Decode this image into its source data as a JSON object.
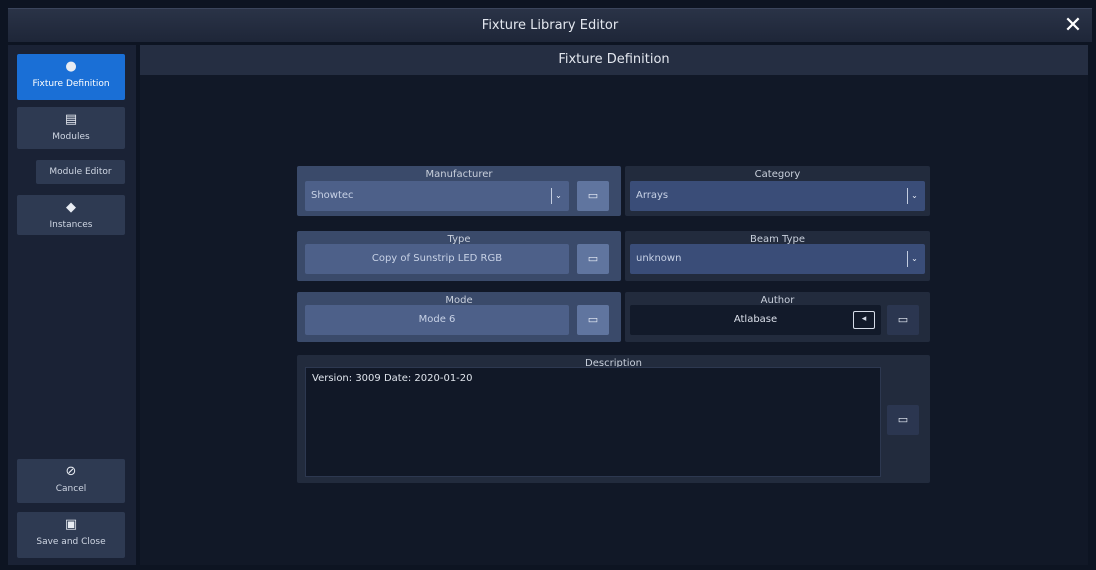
{
  "window": {
    "title": "Fixture Library Editor",
    "close_glyph": "✕"
  },
  "sidebar": {
    "items": [
      {
        "label": "Fixture Definition",
        "icon": "fixture-icon",
        "glyph": "●"
      },
      {
        "label": "Modules",
        "icon": "document-icon",
        "glyph": "▤"
      },
      {
        "label": "Module Editor"
      },
      {
        "label": "Instances",
        "icon": "stack-icon",
        "glyph": "◆"
      }
    ],
    "cancel": {
      "label": "Cancel",
      "icon": "cancel-icon",
      "glyph": "⊘"
    },
    "save": {
      "label": "Save and Close",
      "icon": "save-icon",
      "glyph": "▣"
    }
  },
  "main": {
    "header": "Fixture Definition",
    "manufacturer": {
      "label": "Manufacturer",
      "value": "Showtec"
    },
    "category": {
      "label": "Category",
      "value": "Arrays"
    },
    "type": {
      "label": "Type",
      "value": "Copy of Sunstrip LED RGB"
    },
    "beam_type": {
      "label": "Beam Type",
      "value": "unknown"
    },
    "mode": {
      "label": "Mode",
      "value": "Mode 6"
    },
    "author": {
      "label": "Author",
      "value": "Atlabase"
    },
    "description": {
      "label": "Description",
      "value": "Version: 3009 Date: 2020-01-20"
    },
    "dropdown_glyph": "⌄",
    "keyboard_glyph": "▭",
    "back_glyph": "◂"
  },
  "colors": {
    "accent": "#1a6fd6",
    "panel": "#222b3d",
    "field": "#4d6089"
  }
}
